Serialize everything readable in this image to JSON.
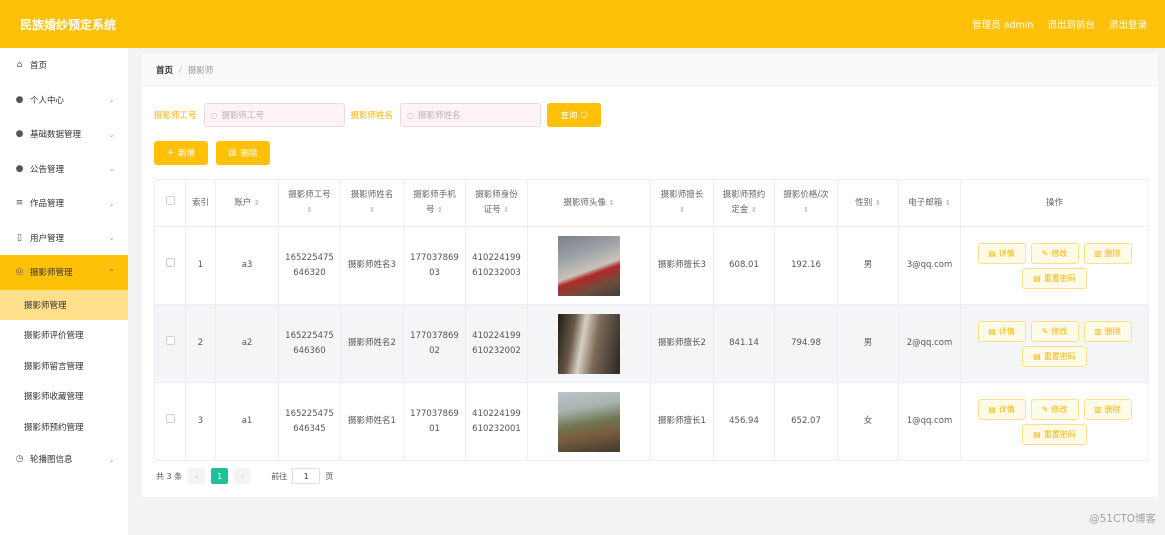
{
  "header": {
    "title": "民族婚纱预定系统",
    "user": "管理员 admin",
    "front": "退出到前台",
    "logout": "退出登录"
  },
  "sidebar": {
    "items": [
      {
        "label": "首页",
        "icon": "home-icon",
        "chevron": false
      },
      {
        "label": "个人中心",
        "icon": "user-icon",
        "chevron": true
      },
      {
        "label": "基础数据管理",
        "icon": "location-icon",
        "chevron": true
      },
      {
        "label": "公告管理",
        "icon": "user-icon",
        "chevron": true
      },
      {
        "label": "作品管理",
        "icon": "layers-icon",
        "chevron": true
      },
      {
        "label": "用户管理",
        "icon": "phone-icon",
        "chevron": true
      },
      {
        "label": "摄影师管理",
        "icon": "compass-icon",
        "chevron": true,
        "open": true
      }
    ],
    "subitems": [
      "摄影师管理",
      "摄影师评价管理",
      "摄影师留言管理",
      "摄影师收藏管理",
      "摄影师预约管理"
    ],
    "last": {
      "label": "轮播图信息",
      "icon": "clock-icon"
    }
  },
  "breadcrumb": {
    "home": "首页",
    "sep": "/",
    "current": "摄影师"
  },
  "search": {
    "label1": "摄影师工号",
    "placeholder1": "摄影师工号",
    "label2": "摄影师姓名",
    "placeholder2": "摄影师姓名",
    "query": "查询"
  },
  "toolbar": {
    "add": "新增",
    "delete": "删除"
  },
  "table": {
    "headers": {
      "index": "索引",
      "account": "账户",
      "workno_1": "摄影师工号",
      "name": "摄影师姓名",
      "phone_1": "摄影师手机",
      "phone_2": "号",
      "idcard_1": "摄影师身份",
      "idcard_2": "证号",
      "avatar": "摄影师头像",
      "specialty": "摄影师擅长",
      "deposit_1": "摄影师预约",
      "deposit_2": "定金",
      "price": "摄影价格/次",
      "gender": "性别",
      "email": "电子邮箱",
      "ops": "操作"
    },
    "rows": [
      {
        "index": "1",
        "account": "a3",
        "workno_1": "165225475",
        "workno_2": "646320",
        "name": "摄影师姓名3",
        "phone_1": "177037869",
        "phone_2": "03",
        "idcard_1": "410224199",
        "idcard_2": "610232003",
        "specialty": "摄影师擅长3",
        "deposit": "608.01",
        "price": "192.16",
        "gender": "男",
        "email": "3@qq.com"
      },
      {
        "index": "2",
        "account": "a2",
        "workno_1": "165225475",
        "workno_2": "646360",
        "name": "摄影师姓名2",
        "phone_1": "177037869",
        "phone_2": "02",
        "idcard_1": "410224199",
        "idcard_2": "610232002",
        "specialty": "摄影师擅长2",
        "deposit": "841.14",
        "price": "794.98",
        "gender": "男",
        "email": "2@qq.com"
      },
      {
        "index": "3",
        "account": "a1",
        "workno_1": "165225475",
        "workno_2": "646345",
        "name": "摄影师姓名1",
        "phone_1": "177037869",
        "phone_2": "01",
        "idcard_1": "410224199",
        "idcard_2": "610232001",
        "specialty": "摄影师擅长1",
        "deposit": "456.94",
        "price": "652.07",
        "gender": "女",
        "email": "1@qq.com"
      }
    ],
    "ops": {
      "detail": "详情",
      "edit": "修改",
      "delete": "删除",
      "reset": "重置密码"
    }
  },
  "pager": {
    "total": "共 3 条",
    "page": "1",
    "goto_prefix": "前往",
    "goto_value": "1",
    "goto_suffix": "页"
  },
  "watermark": "@51CTO博客",
  "colors": {
    "accent": "#ffc107",
    "pager_active": "#1fbf9a"
  }
}
